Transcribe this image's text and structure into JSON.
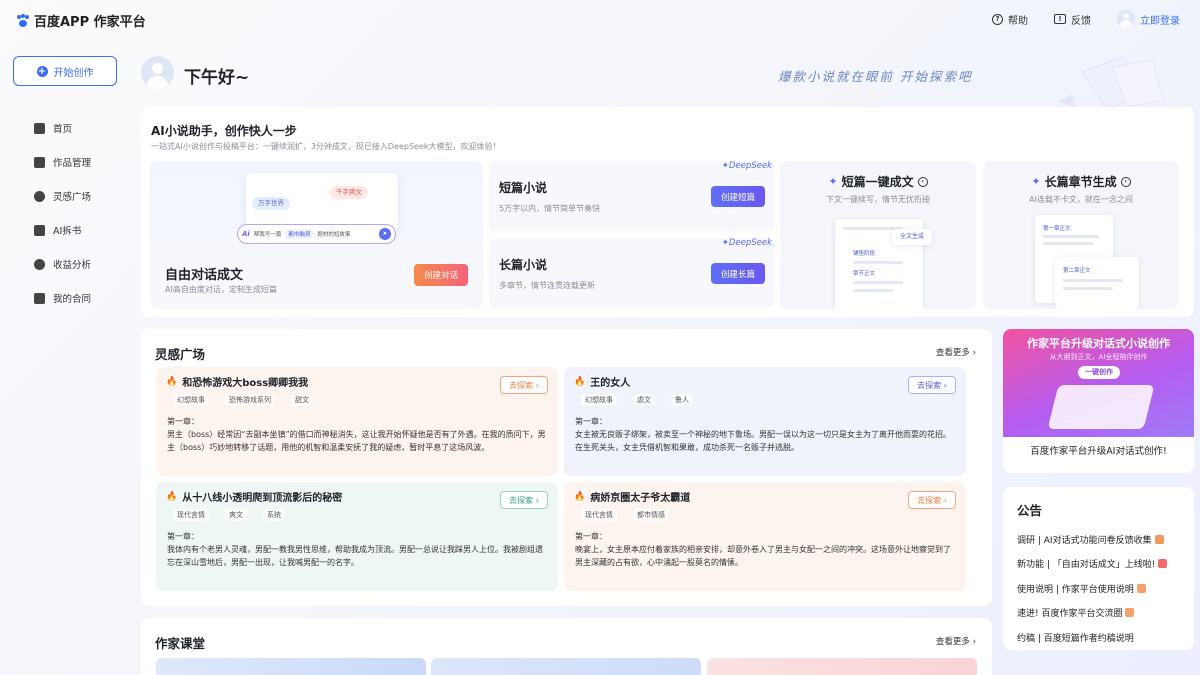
{
  "header": {
    "logo_text": "百度APP 作家平台",
    "help": "帮助",
    "feedback": "反馈",
    "login": "立即登录"
  },
  "sidebar": {
    "create": "开始创作",
    "items": [
      {
        "label": "首页",
        "icon": "home-icon"
      },
      {
        "label": "作品管理",
        "icon": "works-icon"
      },
      {
        "label": "灵感广场",
        "icon": "inspiration-icon"
      },
      {
        "label": "AI拆书",
        "icon": "ai-book-icon"
      },
      {
        "label": "收益分析",
        "icon": "income-icon"
      },
      {
        "label": "我的合同",
        "icon": "contract-icon"
      }
    ]
  },
  "greeting": {
    "text": "下午好~",
    "slogan": "爆款小说就在眼前  开始探索吧"
  },
  "ai": {
    "title": "AI小说助手，创作快人一步",
    "subtitle": "一站式AI小说创作与投稿平台：一键续润扩，3分钟成文，现已接入DeepSeek大模型，欢迎体验！",
    "mock": {
      "pill_a": "万字世界",
      "pill_b": "千字爽文",
      "input_prefix": "帮我写一篇",
      "input_tag": "都市脑洞",
      "input_suffix": "题材的短故事",
      "ai_mark": "Ai"
    },
    "free": {
      "title": "自由对话成文",
      "subtitle": "AI高自由度对话，定制生成短篇",
      "button": "创建对话"
    },
    "short": {
      "title": "短篇小说",
      "subtitle": "5万字以内，情节简单节奏快",
      "button": "创建短篇",
      "badge": "DeepSeek"
    },
    "long": {
      "title": "长篇小说",
      "subtitle": "多章节，情节连贯连载更新",
      "button": "创建长篇",
      "badge": "DeepSeek"
    },
    "one_click": {
      "title": "短篇一键成文",
      "subtitle": "下文一键续写，情节无忧衔接",
      "doc_a": "铺垫阶段",
      "doc_b": "全文生成",
      "doc_c": "章节正文"
    },
    "chapter": {
      "title": "长篇章节生成",
      "subtitle": "AI连载不卡文，就在一念之间",
      "doc_a": "第一章正文",
      "doc_b": "第二章正文"
    }
  },
  "inspiration": {
    "title": "灵感广场",
    "see_more": "查看更多 ›",
    "explore_label": "去探索 ›",
    "stories": [
      {
        "title": "和恐怖游戏大boss卿卿我我",
        "tags": [
          "幻想故事",
          "恐怖游戏系列",
          "甜文"
        ],
        "body": "第一章：\n男主（boss）经常因“去副本坐镇”的借口而神秘消失，这让我开始怀疑他是否有了外遇。在我的质问下，男主（boss）巧妙地转移了话题，用他的机智和温柔安抚了我的疑虑，暂时平息了这场风波。"
      },
      {
        "title": "王的女人",
        "tags": [
          "幻想故事",
          "虐文",
          "鲁人"
        ],
        "body": "第一章：\n女主被无良贩子绑架，被卖至一个神秘的地下鲁场。男配一误以为这一切只是女主为了离开他而耍的花招。在生死关头，女主凭借机智和果敢，成功杀死一名贩子并逃脱。"
      },
      {
        "title": "从十八线小透明爬到顶流影后的秘密",
        "tags": [
          "现代言情",
          "爽文",
          "系统"
        ],
        "body": "第一章：\n我体内有个老男人灵魂，男配一教我男性思维，帮助我成为顶流。男配一总说让我踩男人上位。我被剧组遗忘在深山雪地后，男配一出现，让我喊男配一的名字。"
      },
      {
        "title": "病娇京圈太子爷太霸道",
        "tags": [
          "现代言情",
          "都市情感"
        ],
        "body": "第一章：\n晚宴上，女主原本应付着家族的相亲安排，却意外卷入了男主与女配一之间的冲突。这场意外让地察觉到了男主深藏的占有欲，心中涌起一股莫名的情愫。"
      }
    ]
  },
  "promo": {
    "title": "作家平台升级对话式小说创作",
    "subtitle": "从大纲到正文，AI全程陪伴创作",
    "button": "一键创作",
    "caption": "百度作家平台升级AI对话式创作!"
  },
  "notice": {
    "title": "公告",
    "items": [
      {
        "text": "调研 | AI对话式功能问卷反馈收集",
        "color": "#f29a5a"
      },
      {
        "text": "新功能 | 「自由对话成文」上线啦!",
        "color": "#f2696e"
      },
      {
        "text": "使用说明 | 作家平台使用说明",
        "color": "#f5a26a"
      },
      {
        "text": "速进! 百度作家平台交流圈",
        "color": "#f5a26a"
      },
      {
        "text": "约稿 | 百度短篇作者约稿说明",
        "color": ""
      }
    ]
  },
  "classroom": {
    "title": "作家课堂",
    "see_more": "查看更多 ›"
  },
  "colors": {
    "accent": "#3a6df0",
    "orange": "#f58a4b",
    "purple": "#6a58f0"
  }
}
